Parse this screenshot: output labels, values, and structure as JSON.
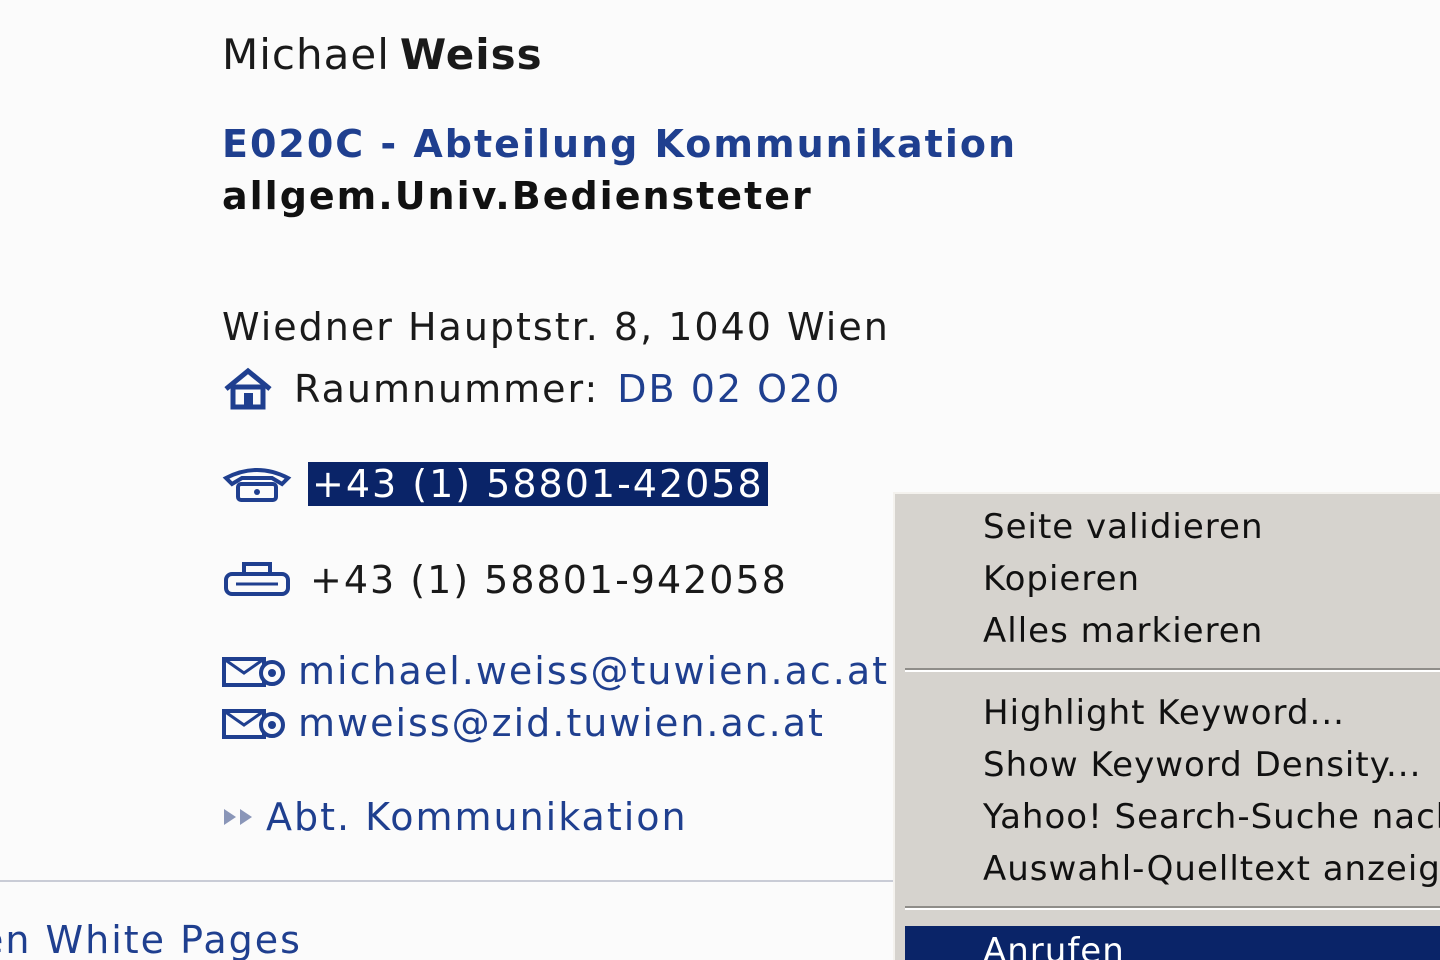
{
  "person": {
    "first_name": "Michael",
    "last_name": "Weiss",
    "department": "E020C - Abteilung Kommunikation",
    "role": "allgem.Univ.Bediensteter"
  },
  "address": {
    "street": "Wiedner Hauptstr. 8, 1040 Wien",
    "room_label": "Raumnummer:",
    "room_value": "DB 02 O20"
  },
  "contact": {
    "phone": "+43 (1) 58801-42058",
    "fax": "+43 (1) 58801-942058",
    "email_1": "michael.weiss@tuwien.ac.at",
    "email_2": "mweiss@zid.tuwien.ac.at"
  },
  "links": {
    "department_link": "Abt. Kommunikation",
    "white_pages": "en White Pages"
  },
  "context_menu": {
    "items": [
      "Seite validieren",
      "Kopieren",
      "Alles markieren",
      "Highlight Keyword...",
      "Show Keyword Density...",
      "Yahoo! Search-Suche nach",
      "Auswahl-Quelltext anzeigen",
      "Anrufen"
    ],
    "highlighted_item": "Anrufen"
  },
  "icons": {
    "room": "house-icon",
    "phone": "telephone-icon",
    "fax": "fax-icon",
    "email": "envelope-at-icon",
    "link": "double-arrow-icon"
  },
  "colors": {
    "link": "#1f3f8f",
    "selection": "#0a2468",
    "menu_bg": "#d6d3ce"
  }
}
